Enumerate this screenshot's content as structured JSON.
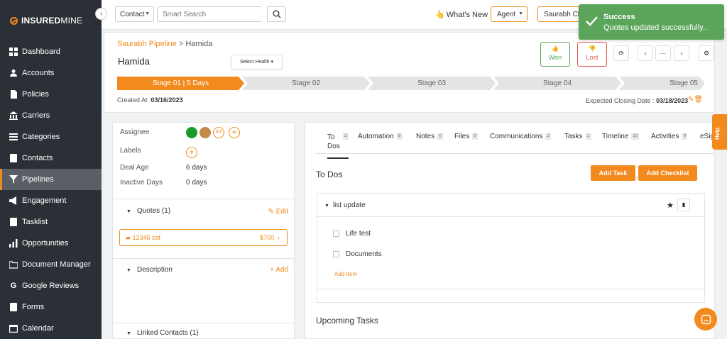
{
  "brand": {
    "name_bold": "INSURED",
    "name_light": "MINE",
    "accent_color": "#f28a1e"
  },
  "sidebar": {
    "items": [
      {
        "label": "Dashboard",
        "icon": "dashboard-icon"
      },
      {
        "label": "Accounts",
        "icon": "users-icon"
      },
      {
        "label": "Policies",
        "icon": "document-icon"
      },
      {
        "label": "Carriers",
        "icon": "building-icon"
      },
      {
        "label": "Categories",
        "icon": "list-icon"
      },
      {
        "label": "Contacts",
        "icon": "contact-card-icon"
      },
      {
        "label": "Pipelines",
        "icon": "filter-icon",
        "active": true
      },
      {
        "label": "Engagement",
        "icon": "megaphone-icon"
      },
      {
        "label": "Tasklist",
        "icon": "checklist-icon"
      },
      {
        "label": "Opportunities",
        "icon": "chart-icon"
      },
      {
        "label": "Document Manager",
        "icon": "folder-icon"
      },
      {
        "label": "Google Reviews",
        "icon": "google-icon"
      },
      {
        "label": "Forms",
        "icon": "form-icon"
      },
      {
        "label": "Calendar",
        "icon": "calendar-icon"
      }
    ]
  },
  "topbar": {
    "contact_select": "Contact",
    "search_placeholder": "Smart Search",
    "whats_new": "What's New",
    "agent_select": "Agent",
    "user_select": "Saurabh Ch"
  },
  "toast": {
    "title": "Success",
    "message": "Quotes updated successfully.."
  },
  "header": {
    "breadcrumb_link": "Saurabh Pipeline",
    "breadcrumb_sep": " > ",
    "breadcrumb_current": "Hamida",
    "deal_title": "Hamida",
    "select_health": "Select Health",
    "won_label": "Won",
    "lost_label": "Lost",
    "stages": [
      "Stage 01 | 5 Days",
      "Stage 02",
      "Stage 03",
      "Stage 04",
      "Stage 05"
    ],
    "created_label": "Created At :",
    "created_value": "03/16/2023",
    "closing_label": "Expected Closing Date :",
    "closing_value": "03/18/2023"
  },
  "details": {
    "assignee_label": "Assignee",
    "assignee_initials": "ST",
    "labels_label": "Labels",
    "deal_age_label": "Deal Age",
    "deal_age_value": "6 days",
    "inactive_days_label": "Inactive Days",
    "inactive_days_value": "0 days",
    "quotes_title": "Quotes (1)",
    "quotes_edit": "Edit",
    "quote_name": "12345 cat",
    "quote_amount": "$700",
    "description_title": "Description",
    "description_add": "Add",
    "linked_contacts_title": "Linked Contacts (1)"
  },
  "tabs": [
    {
      "label_line1": "To",
      "label_line2": "Dos",
      "count": "2"
    },
    {
      "label": "Automation",
      "count": "8"
    },
    {
      "label": "Notes",
      "count": "0"
    },
    {
      "label": "Files",
      "count": "0"
    },
    {
      "label": "Communications",
      "count": "2"
    },
    {
      "label": "Tasks",
      "count": "1"
    },
    {
      "label": "Timeline",
      "count": "10"
    },
    {
      "label": "Activities",
      "count": "0"
    },
    {
      "label": "eSig"
    }
  ],
  "todos": {
    "title": "To Dos",
    "add_task": "Add Task",
    "add_checklist": "Add Checklist",
    "list_name": "list update",
    "items": [
      "Life test",
      "Documents"
    ],
    "add_item": "Add Item",
    "upcoming_title": "Upcoming Tasks"
  },
  "help": {
    "label": "Help"
  }
}
